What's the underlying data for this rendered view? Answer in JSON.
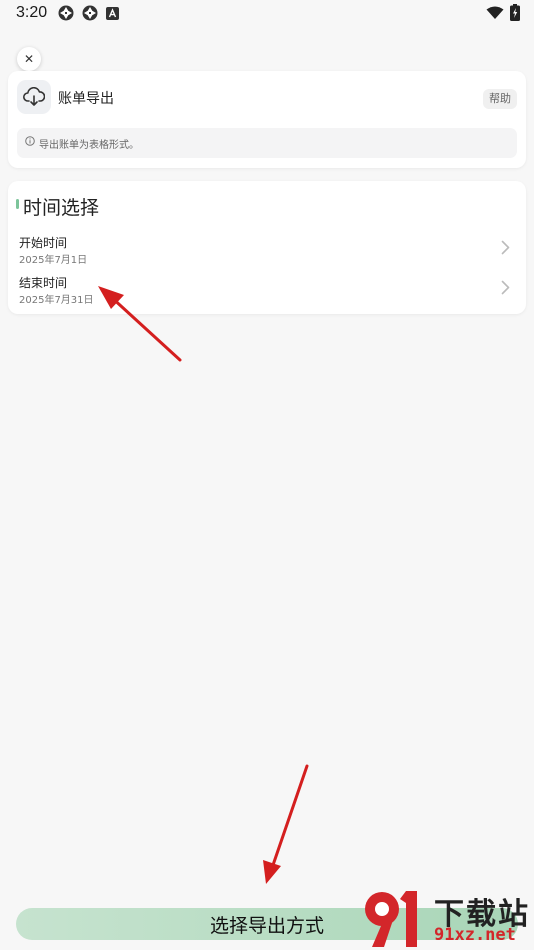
{
  "status_bar": {
    "time": "3:20"
  },
  "header": {
    "close_glyph": "✕"
  },
  "export_card": {
    "title": "账单导出",
    "help_label": "帮助",
    "info_text": "导出账单为表格形式。"
  },
  "time_section": {
    "title": "时间选择",
    "rows": [
      {
        "label": "开始时间",
        "value": "2025年7月1日"
      },
      {
        "label": "结束时间",
        "value": "2025年7月31日"
      }
    ]
  },
  "bottom": {
    "button_label": "选择导出方式"
  },
  "watermark": {
    "brand_top": "下载站",
    "brand_bottom": "91xz.net"
  },
  "colors": {
    "accent": "#7cc49a",
    "button_gradient_start": "#c6e3cf",
    "arrow": "#d41f1f",
    "watermark_red": "#d3262a"
  }
}
